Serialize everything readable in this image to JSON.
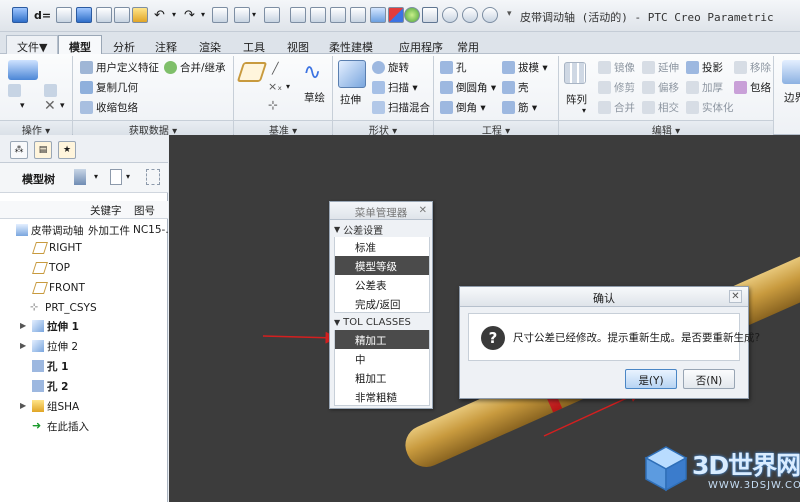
{
  "app": {
    "title": "皮带调动轴 (活动的) - PTC Creo Parametric",
    "qat_prefix": "d="
  },
  "ribbon_tabs": [
    "文件▼",
    "模型",
    "分析",
    "注释",
    "渲染",
    "工具",
    "视图",
    "柔性建模",
    "应用程序",
    "常用"
  ],
  "ribbon": {
    "ops_label": "操作 ▾",
    "getdata": {
      "label": "获取数据 ▾",
      "items": [
        "用户定义特征",
        "合并/继承",
        "复制几何",
        "收缩包络"
      ]
    },
    "datum": {
      "label": "基准 ▾",
      "sketch": "草绘"
    },
    "shapes": {
      "label": "形状 ▾",
      "extrude": "拉伸",
      "revolve": "旋转",
      "sweep": "扫描 ▾",
      "swept_blend": "扫描混合"
    },
    "engineering": {
      "label": "工程 ▾",
      "items": [
        "孔",
        "倒圆角 ▾",
        "倒角 ▾",
        "拔模 ▾",
        "壳",
        "筋 ▾"
      ]
    },
    "editing": {
      "label": "编辑 ▾",
      "pattern": "阵列",
      "items": [
        "镜像",
        "修剪",
        "合并",
        "延伸",
        "偏移",
        "相交",
        "投影",
        "加厚",
        "实体化",
        "移除",
        "包络"
      ],
      "more": "边界"
    }
  },
  "model_tree": {
    "title": "模型树",
    "columns": [
      "关键字",
      "图号"
    ],
    "root": {
      "name": "皮带调动轴",
      "keyword": "外加工件",
      "drawing_no": "NC15-..."
    },
    "items": [
      "RIGHT",
      "TOP",
      "FRONT",
      "PRT_CSYS",
      "拉伸 1",
      "拉伸 2",
      "孔 1",
      "孔 2",
      "组SHA",
      "在此插入"
    ]
  },
  "menu_manager": {
    "title": "菜单管理器",
    "section1": "公差设置",
    "section1_items": [
      "标准",
      "模型等级",
      "公差表",
      "完成/返回"
    ],
    "section2": "TOL CLASSES",
    "section2_items": [
      "精加工",
      "中",
      "粗加工",
      "非常粗糙"
    ]
  },
  "dialog": {
    "title": "确认",
    "message": "尺寸公差已经修改。提示重新生成。是否要重新生成?",
    "yes": "是(Y)",
    "no": "否(N)"
  },
  "watermark": {
    "brand": "3D世界网",
    "url": "WWW.3DSJW.COM"
  },
  "colors": {
    "accent_red": "#d41f1f",
    "selected_item": "#4b4b4b",
    "canvas": "#3c3c3c",
    "rod": "#c89a3e"
  }
}
